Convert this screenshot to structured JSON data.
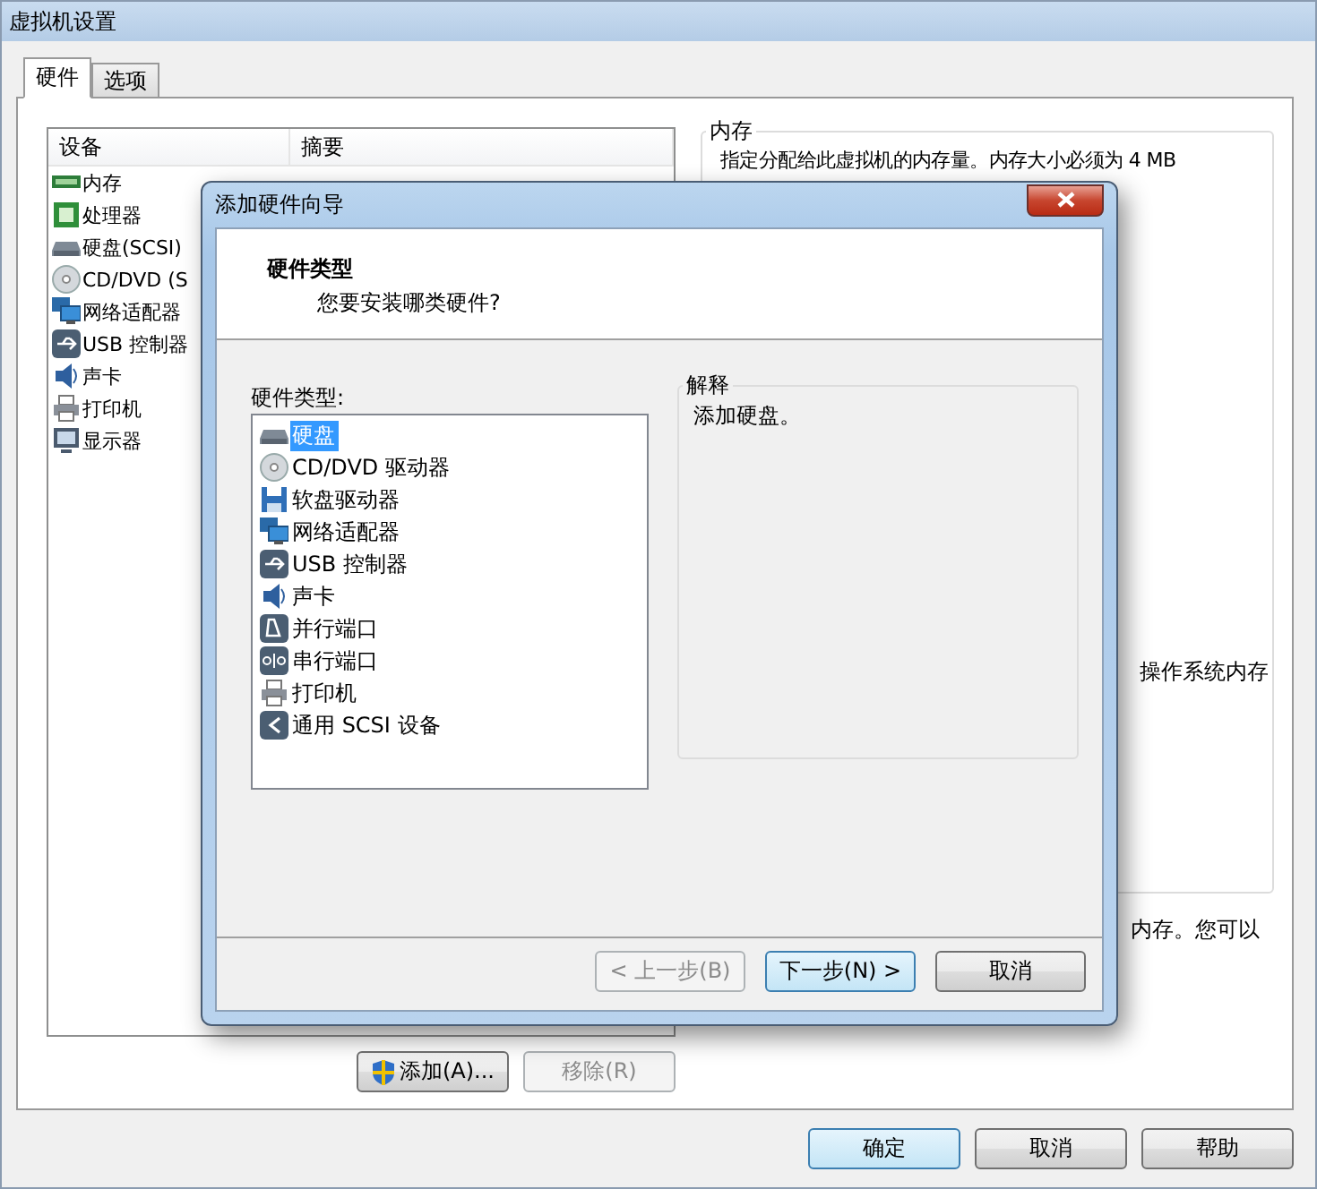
{
  "window": {
    "title": "虚拟机设置"
  },
  "tabs": [
    {
      "label": "硬件",
      "selected": true
    },
    {
      "label": "选项",
      "selected": false
    }
  ],
  "device_list": {
    "columns": [
      "设备",
      "摘要"
    ],
    "rows": [
      {
        "device": "内存"
      },
      {
        "device": "处理器"
      },
      {
        "device": "硬盘(SCSI)"
      },
      {
        "device": "CD/DVD (S"
      },
      {
        "device": "网络适配器"
      },
      {
        "device": "USB 控制器"
      },
      {
        "device": "声卡"
      },
      {
        "device": "打印机"
      },
      {
        "device": "显示器"
      }
    ]
  },
  "memory_group": {
    "title": "内存",
    "description": "指定分配给此虚拟机的内存量。内存大小必须为 4 MB",
    "fragment": "操作系统内存"
  },
  "memory_note": "内存。您可以",
  "list_buttons": [
    {
      "label": "添加(A)...",
      "disabled": false
    },
    {
      "label": "移除(R)",
      "disabled": true
    }
  ],
  "footer_buttons": [
    {
      "label": "确定",
      "default": true
    },
    {
      "label": "取消",
      "default": false
    },
    {
      "label": "帮助",
      "default": false
    }
  ],
  "wizard": {
    "title": "添加硬件向导",
    "heading": "硬件类型",
    "subheading": "您要安装哪类硬件?",
    "list_label": "硬件类型:",
    "items": [
      {
        "label": "硬盘",
        "selected": true
      },
      {
        "label": "CD/DVD 驱动器",
        "selected": false
      },
      {
        "label": "软盘驱动器",
        "selected": false
      },
      {
        "label": "网络适配器",
        "selected": false
      },
      {
        "label": "USB 控制器",
        "selected": false
      },
      {
        "label": "声卡",
        "selected": false
      },
      {
        "label": "并行端口",
        "selected": false
      },
      {
        "label": "串行端口",
        "selected": false
      },
      {
        "label": "打印机",
        "selected": false
      },
      {
        "label": "通用 SCSI 设备",
        "selected": false
      }
    ],
    "explanation": {
      "title": "解释",
      "text": "添加硬盘。"
    },
    "buttons": [
      {
        "label": "< 上一步(B)",
        "disabled": true,
        "default": false
      },
      {
        "label": "下一步(N) >",
        "disabled": false,
        "default": true
      },
      {
        "label": "取消",
        "disabled": false,
        "default": false
      }
    ]
  }
}
